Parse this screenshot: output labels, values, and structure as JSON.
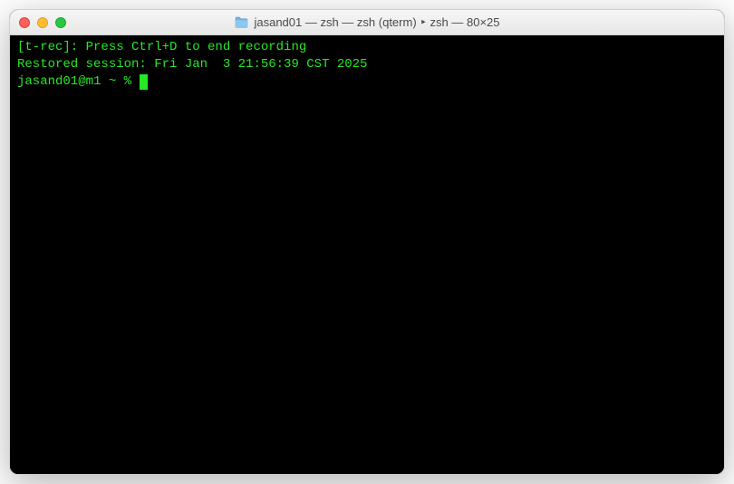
{
  "window": {
    "title": "jasand01 — zsh — zsh (qterm) ‣ zsh — 80×25"
  },
  "terminal": {
    "lines": [
      "[t-rec]: Press Ctrl+D to end recording",
      "Restored session: Fri Jan  3 21:56:39 CST 2025"
    ],
    "prompt": "jasand01@m1 ~ % "
  }
}
